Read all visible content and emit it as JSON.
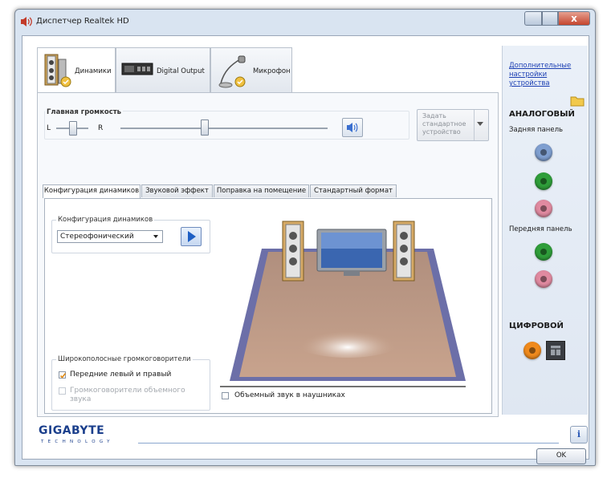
{
  "window": {
    "title": "Диспетчер Realtek HD",
    "close_glyph": "x"
  },
  "device_tabs": [
    {
      "label": "Динамики",
      "icon": "speakers-icon"
    },
    {
      "label": "Digital Output",
      "icon": "digital-output-icon"
    },
    {
      "label": "Микрофон",
      "icon": "microphone-icon"
    }
  ],
  "volume": {
    "title": "Главная громкость",
    "left_label": "L",
    "right_label": "R",
    "balance": 0.5,
    "level": 0.4,
    "mute_icon": "speaker-volume-icon"
  },
  "default_device_button": "Задать стандартное устройство",
  "sub_tabs": [
    "Конфигурация динамиков",
    "Звуковой эффект",
    "Поправка на помещение",
    "Стандартный формат"
  ],
  "speaker_config": {
    "group_title": "Конфигурация динамиков",
    "selected": "Стереофонический",
    "play_icon": "play-icon"
  },
  "fullrange": {
    "group_title": "Широкополосные громкоговорители",
    "front_label": "Передние левый и правый",
    "front_checked": true,
    "surround_label": "Громкоговорители объемного звука",
    "surround_checked": false
  },
  "headphones_virtual": {
    "label": "Объемный звук в наушниках",
    "checked": false
  },
  "sidebar": {
    "link": "Дополнительные настройки устройства",
    "analog_title": "АНАЛОГОВЫЙ",
    "rear_panel": "Задняя панель",
    "front_panel": "Передняя панель",
    "digital_title": "ЦИФРОВОЙ",
    "jack_colors": {
      "blue": "#7f9fd0",
      "green": "#2f9e3a",
      "pink": "#e08aa0",
      "orange": "#f08a1c"
    }
  },
  "brand": {
    "name": "GIGABYTE",
    "tagline": "TECHNOLOGY"
  },
  "buttons": {
    "ok": "OK",
    "info_glyph": "i"
  }
}
